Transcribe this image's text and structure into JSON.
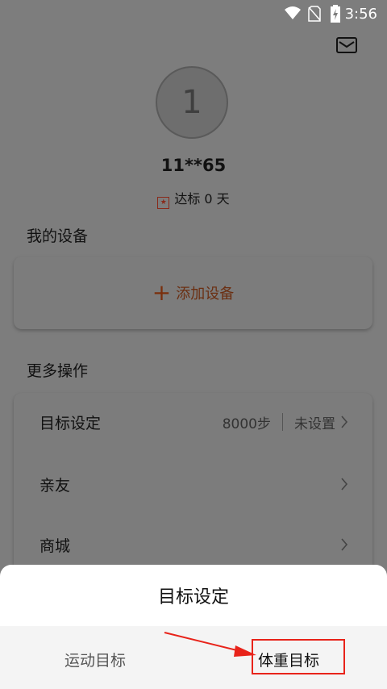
{
  "status_bar": {
    "time": "3:56"
  },
  "profile": {
    "avatar_initial": "1",
    "username": "11**65",
    "streak_text": "达标 0 天"
  },
  "devices": {
    "section_title": "我的设备",
    "add_label": "添加设备"
  },
  "operations": {
    "section_title": "更多操作",
    "items": [
      {
        "label": "目标设定",
        "steps": "8000步",
        "status": "未设置"
      },
      {
        "label": "亲友"
      },
      {
        "label": "商城"
      }
    ]
  },
  "sheet": {
    "title": "目标设定",
    "tabs": [
      {
        "label": "运动目标"
      },
      {
        "label": "体重目标"
      }
    ]
  },
  "colors": {
    "overlay": "#7d7d7d",
    "highlight": "#e8231a",
    "accent": "#7a2f0c"
  }
}
